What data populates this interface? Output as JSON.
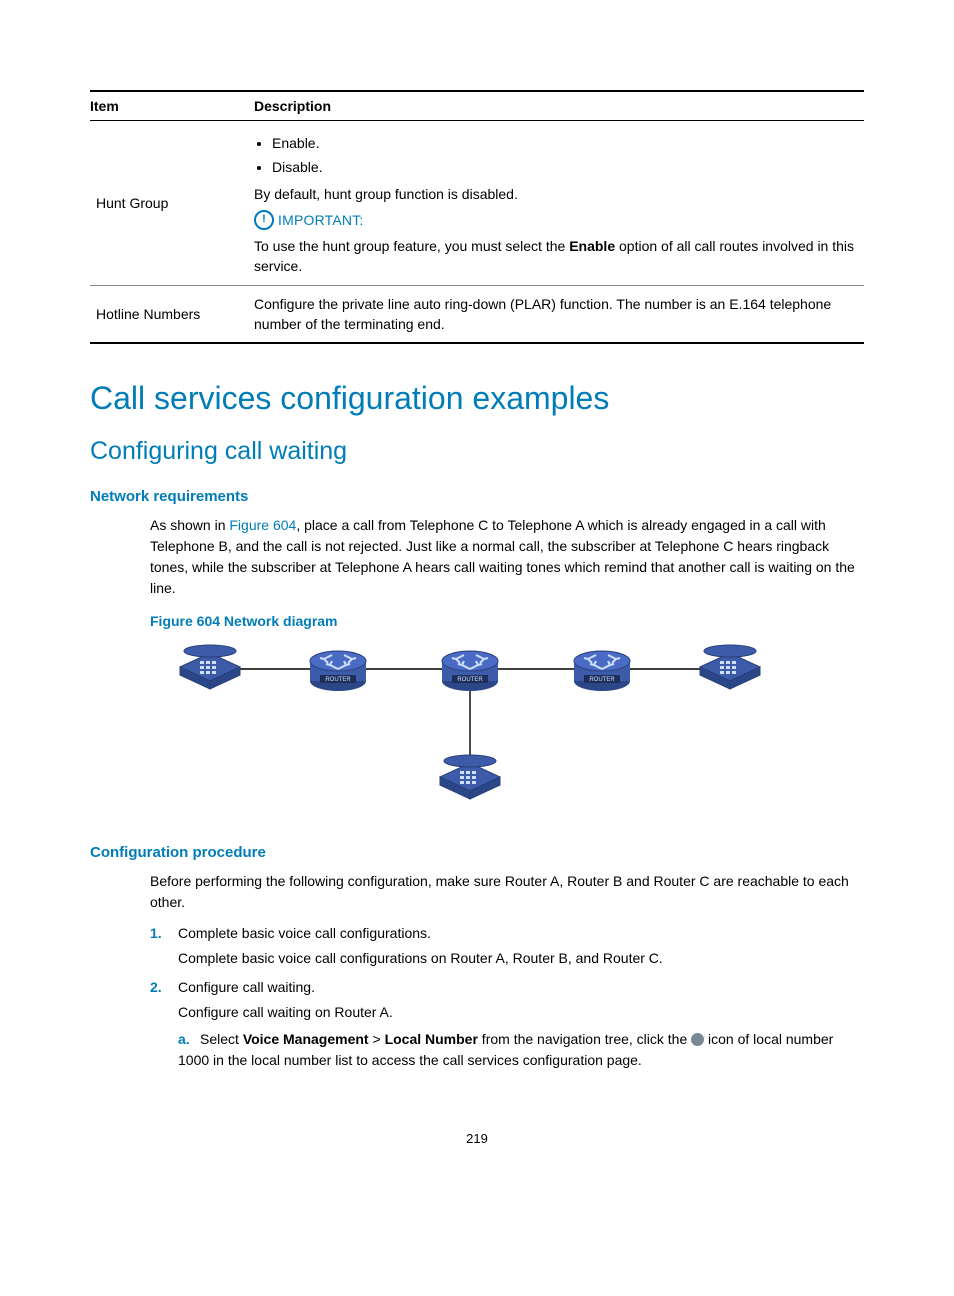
{
  "table": {
    "headers": [
      "Item",
      "Description"
    ],
    "rows": [
      {
        "item": "Hunt Group",
        "bullets": [
          "Enable.",
          "Disable."
        ],
        "default_text": "By default, hunt group function is disabled.",
        "important_label": "IMPORTANT:",
        "important_text_pre": "To use the hunt group feature, you must select the ",
        "important_bold": "Enable",
        "important_text_post": " option of all call routes involved in this service."
      },
      {
        "item": "Hotline Numbers",
        "desc": "Configure the private line auto ring-down (PLAR) function. The number is an E.164 telephone number of the terminating end."
      }
    ]
  },
  "h1": "Call services configuration examples",
  "h2": "Configuring call waiting",
  "netreq": {
    "heading": "Network requirements",
    "para_pre": "As shown in ",
    "fig_ref": "Figure 604",
    "para_post": ", place a call from Telephone C to Telephone A which is already engaged in a call with Telephone B, and the call is not rejected. Just like a normal call, the subscriber at Telephone C hears ringback tones, while the subscriber at Telephone A hears call waiting tones which remind that another call is waiting on the line.",
    "fig_caption": "Figure 604 Network diagram"
  },
  "cfgproc": {
    "heading": "Configuration procedure",
    "intro": "Before performing the following configuration, make sure Router A, Router B and Router C are reachable to each other.",
    "steps": [
      {
        "marker": "1.",
        "title": "Complete basic voice call configurations.",
        "body": "Complete basic voice call configurations on Router A, Router B, and Router C."
      },
      {
        "marker": "2.",
        "title": "Configure call waiting.",
        "body": "Configure call waiting on Router A.",
        "sub": {
          "marker": "a.",
          "pre": "Select ",
          "b1": "Voice Management",
          "gt": " > ",
          "b2": "Local Number",
          "mid": " from the navigation tree, click the ",
          "post": " icon of local number 1000 in the local number list to access the call services configuration page."
        }
      }
    ]
  },
  "page_number": "219"
}
